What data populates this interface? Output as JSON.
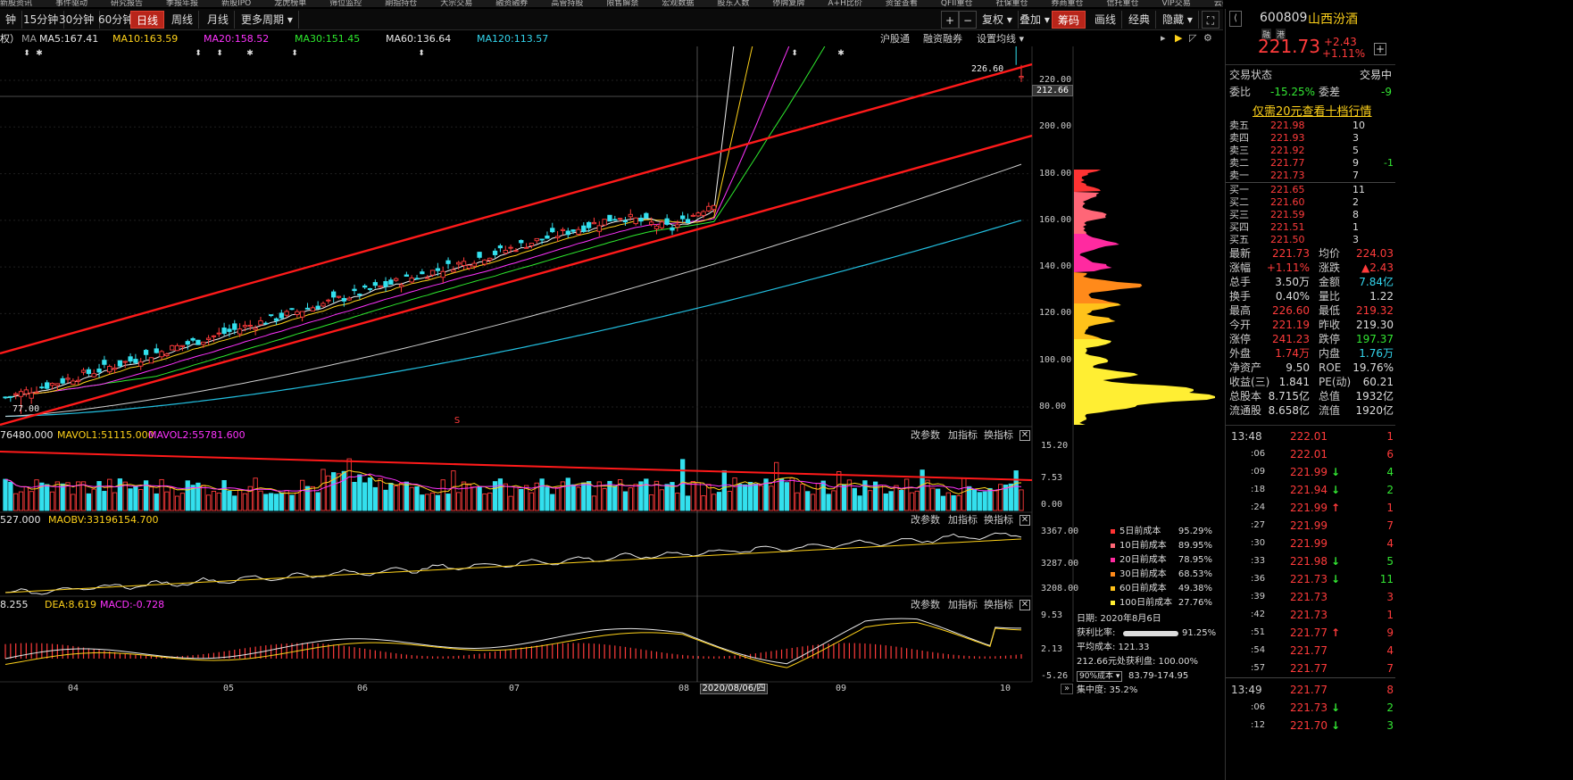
{
  "topnav": [
    "新股资讯",
    "事件驱动",
    "研究报告",
    "季报年报",
    "新股IPO",
    "龙虎榜单",
    "筛位监控",
    "期指持仓",
    "大宗交易",
    "融资融券",
    "高管持股",
    "限售解禁",
    "宏观数据",
    "股东人数",
    "停牌复牌",
    "A+H比价",
    "资金查看",
    "QFII重仓",
    "社保重仓",
    "券商重仓",
    "信托重仓",
    "VIP交易",
    "云养盘"
  ],
  "toolbar": {
    "periods": [
      "钟",
      "15分钟",
      "30分钟",
      "60分钟",
      "日线",
      "周线",
      "月线",
      "更多周期 ▾"
    ],
    "active": "日线",
    "plus": "+",
    "minus": "−",
    "right": [
      "复权 ▾",
      "叠加 ▾",
      "筹码",
      "画线",
      "经典",
      "隐藏 ▾"
    ],
    "right_active": "筹码"
  },
  "ma": {
    "prefix": "权）",
    "name": "MA",
    "ma5": "MA5:167.41",
    "ma10": "MA10:163.59",
    "ma20": "MA20:158.52",
    "ma30": "MA30:151.45",
    "ma60": "MA60:136.64",
    "ma120": "MA120:113.57",
    "links": [
      "沪股通",
      "融资融券",
      "设置均线 ▾"
    ]
  },
  "price_axis": {
    "ticks": [
      "220.00",
      "200.00",
      "180.00",
      "160.00",
      "140.00",
      "120.00",
      "100.00",
      "80.00"
    ],
    "cursor": "212.66",
    "high_label": "226.60",
    "low_label": "77.00"
  },
  "vol": {
    "v0": "76480.000",
    "l1": "MAVOL1:51115.000",
    "l2": "MAVOL2:55781.600",
    "ticks": [
      "15.20",
      "7.53",
      "0.00"
    ],
    "tools": [
      "改参数",
      "加指标",
      "换指标"
    ]
  },
  "obv": {
    "v0": "527.000",
    "l1": "MAOBV:33196154.700",
    "ticks": [
      "3367.00",
      "3287.00",
      "3208.00"
    ],
    "tools": [
      "改参数",
      "加指标",
      "换指标"
    ]
  },
  "macd": {
    "diff": "8.255",
    "dea": "DEA:8.619",
    "macd": "MACD:-0.728",
    "ticks": [
      "9.53",
      "2.13",
      "-5.26"
    ],
    "tools": [
      "改参数",
      "加指标",
      "换指标"
    ]
  },
  "x_axis": {
    "labels": [
      "04",
      "05",
      "06",
      "07",
      "08",
      "09",
      "10"
    ],
    "cursor_date": "2020/08/06/四"
  },
  "chips": {
    "legend": [
      {
        "label": "5日前成本",
        "pct": "95.29%",
        "color": "#ff3333"
      },
      {
        "label": "10日前成本",
        "pct": "89.95%",
        "color": "#ff6677"
      },
      {
        "label": "20日前成本",
        "pct": "78.95%",
        "color": "#ff2aa0"
      },
      {
        "label": "30日前成本",
        "pct": "68.53%",
        "color": "#ff8a1a"
      },
      {
        "label": "60日前成本",
        "pct": "49.38%",
        "color": "#ffc21a"
      },
      {
        "label": "100日前成本",
        "pct": "27.76%",
        "color": "#ffee33"
      }
    ],
    "date": "日期: 2020年8月6日",
    "profit_label": "获利比率:",
    "profit_pct": "91.25%",
    "avg_cost": "平均成本: 121.33",
    "profit_at": "212.66元处获利盘: 100.00%",
    "cost_range_select": "90%成本 ▾",
    "cost_range": "83.79-174.95",
    "concentration": "集中度: 35.2%"
  },
  "quote": {
    "code": "600809",
    "name": "山西汾酒",
    "badge1": "融",
    "badge2": "港",
    "price": "221.73",
    "change": "+2.43",
    "change_pct": "+1.11%",
    "trade_status_label": "交易状态",
    "trade_status": "交易中",
    "weibi_label": "委比",
    "weibi": "-15.25%",
    "weicha_label": "委差",
    "weicha": "-9",
    "promo": "仅需20元查看十档行情"
  },
  "orderbook": {
    "sell": [
      {
        "l": "卖五",
        "p": "221.98",
        "v": "10",
        "c": ""
      },
      {
        "l": "卖四",
        "p": "221.93",
        "v": "3",
        "c": ""
      },
      {
        "l": "卖三",
        "p": "221.92",
        "v": "5",
        "c": ""
      },
      {
        "l": "卖二",
        "p": "221.77",
        "v": "9",
        "c": "-1"
      },
      {
        "l": "卖一",
        "p": "221.73",
        "v": "7",
        "c": ""
      }
    ],
    "buy": [
      {
        "l": "买一",
        "p": "221.65",
        "v": "11",
        "c": ""
      },
      {
        "l": "买二",
        "p": "221.60",
        "v": "2",
        "c": ""
      },
      {
        "l": "买三",
        "p": "221.59",
        "v": "8",
        "c": ""
      },
      {
        "l": "买四",
        "p": "221.51",
        "v": "1",
        "c": ""
      },
      {
        "l": "买五",
        "p": "221.50",
        "v": "3",
        "c": ""
      }
    ]
  },
  "stats": [
    [
      "最新",
      "221.73",
      "均价",
      "224.03"
    ],
    [
      "涨幅",
      "+1.11%",
      "涨跌",
      "▲2.43"
    ],
    [
      "总手",
      "3.50万",
      "金额",
      "7.84亿"
    ],
    [
      "换手",
      "0.40%",
      "量比",
      "1.22"
    ],
    [
      "最高",
      "226.60",
      "最低",
      "219.32"
    ],
    [
      "今开",
      "221.19",
      "昨收",
      "219.30"
    ],
    [
      "涨停",
      "241.23",
      "跌停",
      "197.37"
    ],
    [
      "外盘",
      "1.74万",
      "内盘",
      "1.76万"
    ],
    [
      "净资产",
      "9.50",
      "ROE",
      "19.76%"
    ],
    [
      "收益(三)",
      "1.841",
      "PE(动)",
      "60.21"
    ],
    [
      "总股本",
      "8.715亿",
      "总值",
      "1932亿"
    ],
    [
      "流通股",
      "8.658亿",
      "流值",
      "1920亿"
    ]
  ],
  "ticks": [
    {
      "t": "13:48",
      "p": "222.01",
      "a": "",
      "v": "1"
    },
    {
      "t": ":06",
      "p": "222.01",
      "a": "",
      "v": "6"
    },
    {
      "t": ":09",
      "p": "221.99",
      "a": "↓",
      "v": "4"
    },
    {
      "t": ":18",
      "p": "221.94",
      "a": "↓",
      "v": "2"
    },
    {
      "t": ":24",
      "p": "221.99",
      "a": "↑",
      "v": "1"
    },
    {
      "t": ":27",
      "p": "221.99",
      "a": "",
      "v": "7"
    },
    {
      "t": ":30",
      "p": "221.99",
      "a": "",
      "v": "4"
    },
    {
      "t": ":33",
      "p": "221.98",
      "a": "↓",
      "v": "5"
    },
    {
      "t": ":36",
      "p": "221.73",
      "a": "↓",
      "v": "11"
    },
    {
      "t": ":39",
      "p": "221.73",
      "a": "",
      "v": "3"
    },
    {
      "t": ":42",
      "p": "221.73",
      "a": "",
      "v": "1"
    },
    {
      "t": ":51",
      "p": "221.77",
      "a": "↑",
      "v": "9"
    },
    {
      "t": ":54",
      "p": "221.77",
      "a": "",
      "v": "4"
    },
    {
      "t": ":57",
      "p": "221.77",
      "a": "",
      "v": "7"
    },
    {
      "t": "13:49",
      "p": "221.77",
      "a": "",
      "v": "8"
    },
    {
      "t": ":06",
      "p": "221.73",
      "a": "↓",
      "v": "2"
    },
    {
      "t": ":12",
      "p": "221.70",
      "a": "↓",
      "v": "3"
    }
  ]
}
